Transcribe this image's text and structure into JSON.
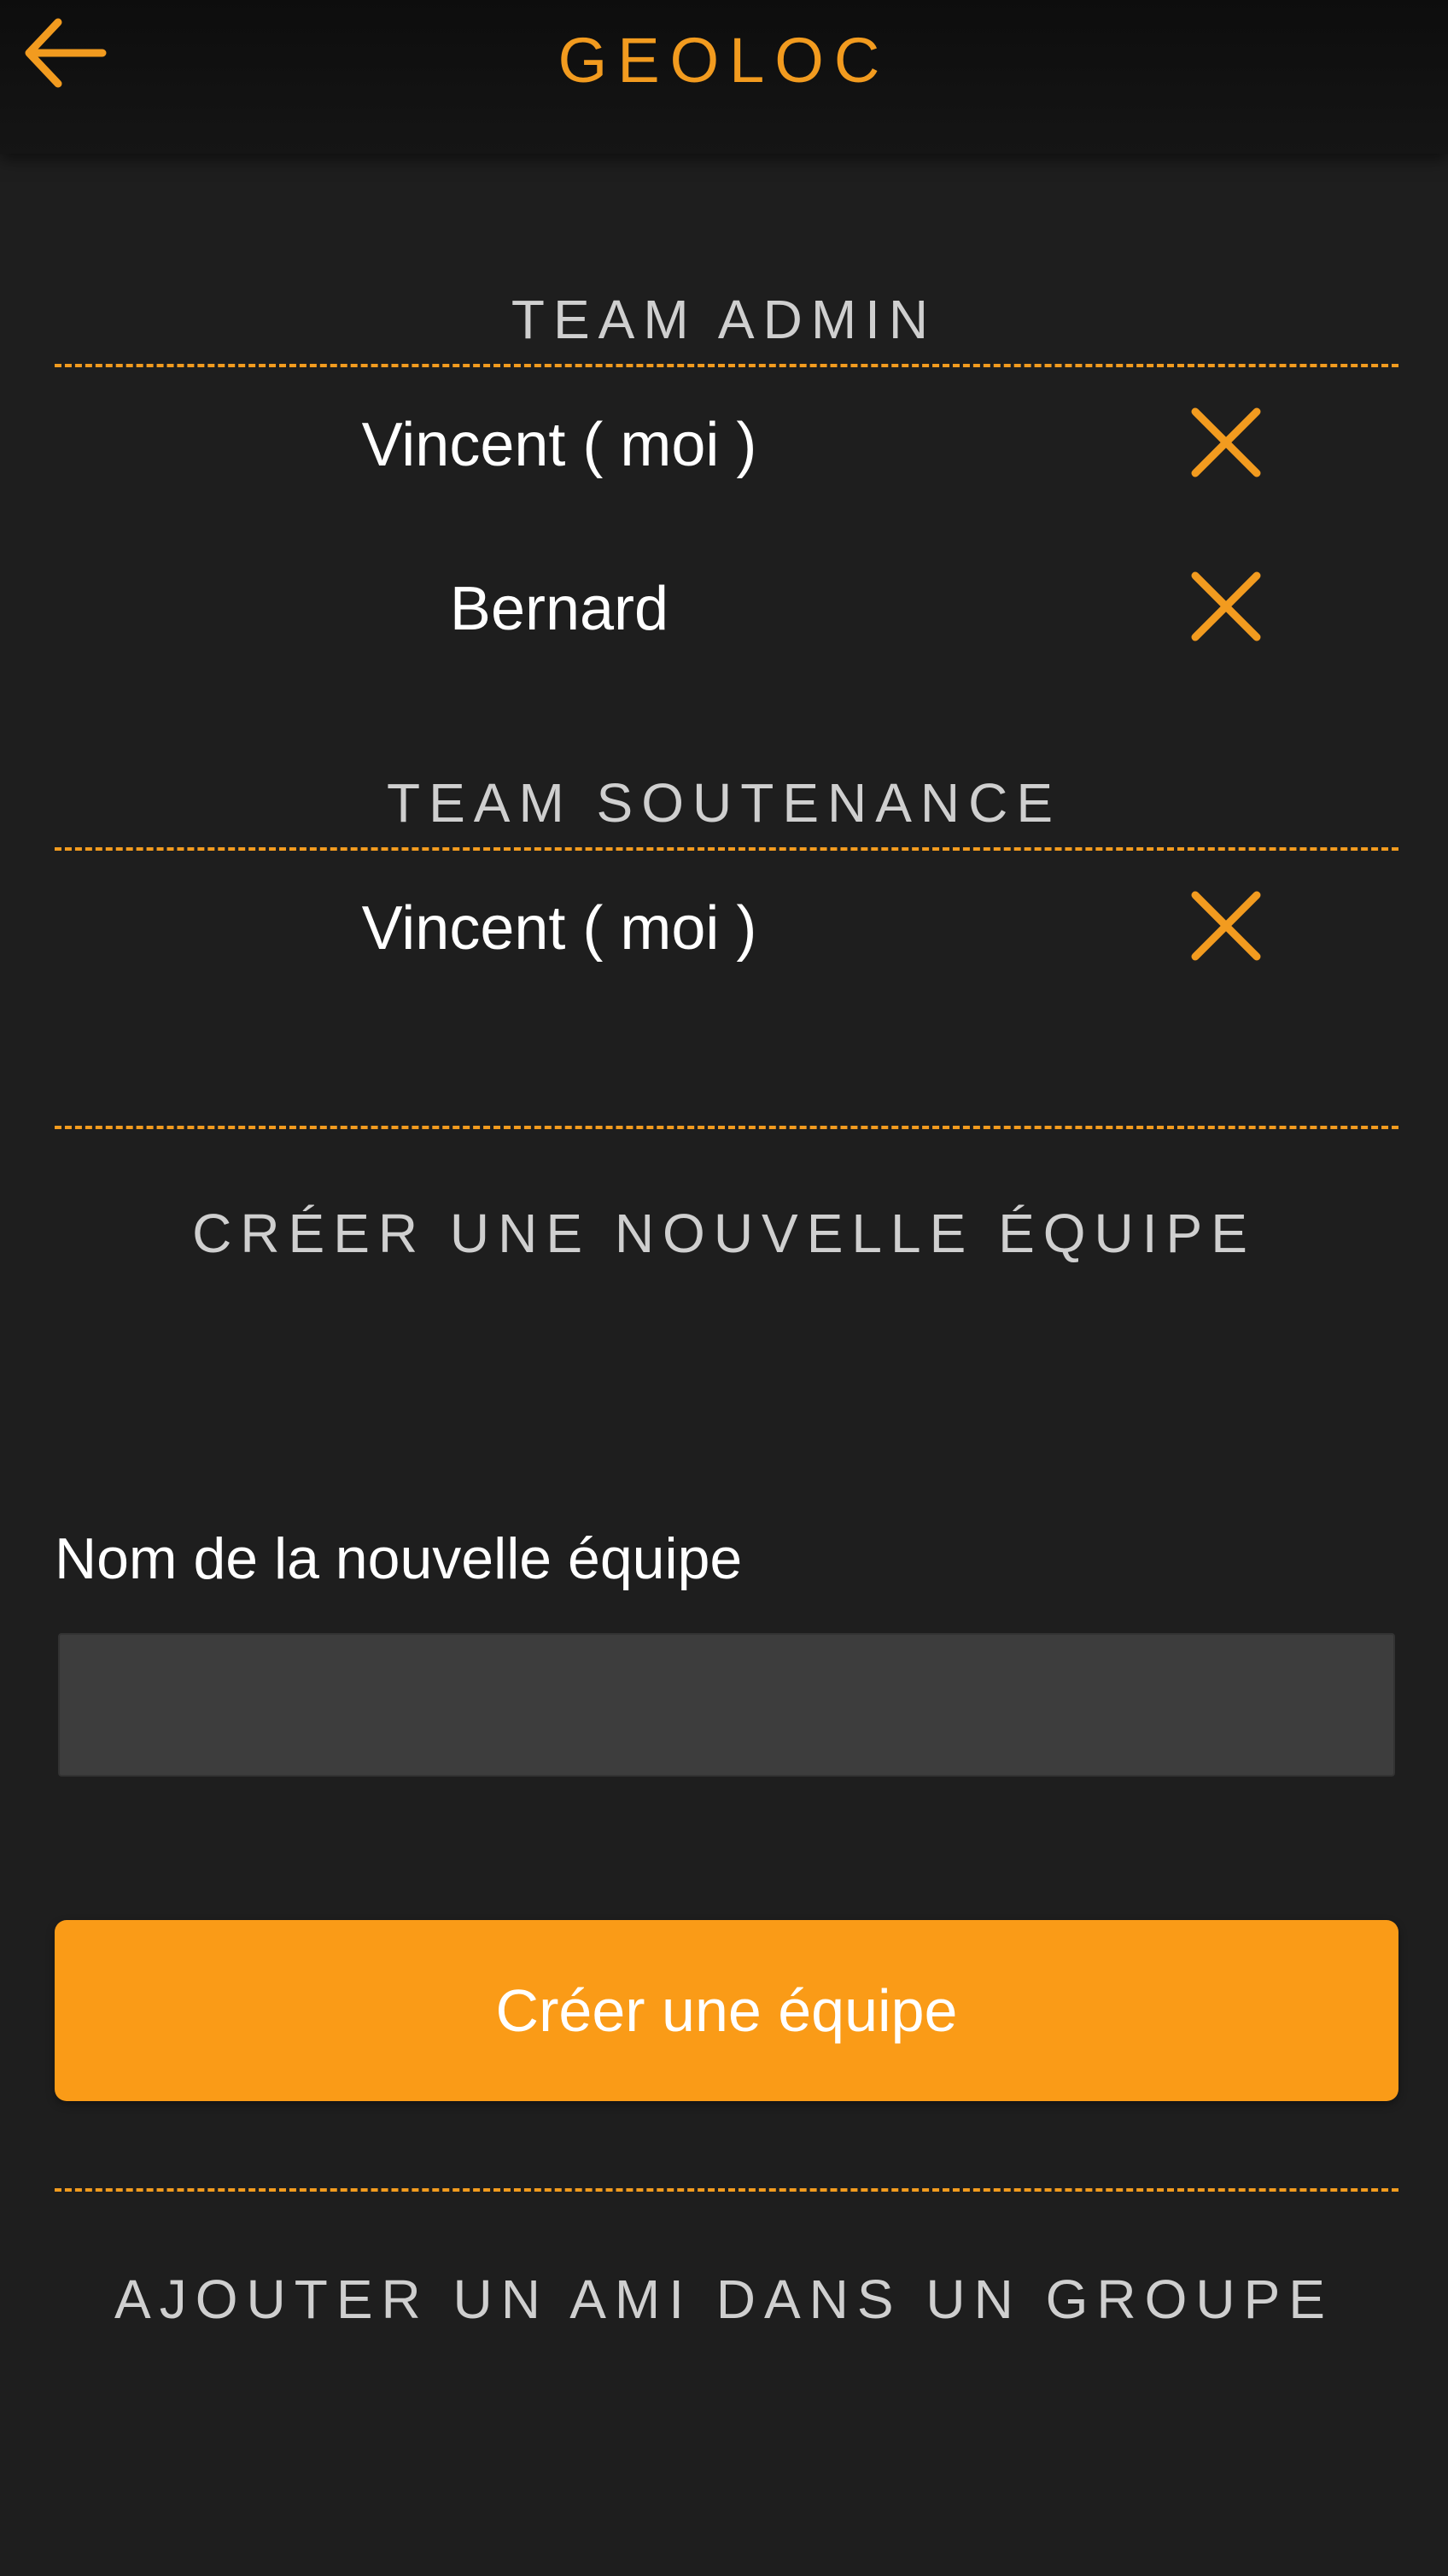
{
  "app": {
    "title": "GEOLOC"
  },
  "icons": {
    "back": "arrow-left-icon",
    "remove": "close-icon"
  },
  "colors": {
    "accent": "#f29b1f",
    "button": "#fa9b17",
    "background": "#1e1e1e",
    "input_bg": "#3d3d3d"
  },
  "teams": [
    {
      "name": "TEAM ADMIN",
      "members": [
        "Vincent ( moi )",
        "Bernard"
      ]
    },
    {
      "name": "TEAM SOUTENANCE",
      "members": [
        "Vincent ( moi )"
      ]
    }
  ],
  "create_team": {
    "heading": "CRÉER UNE NOUVELLE ÉQUIPE",
    "field_label": "Nom de la nouvelle équipe",
    "input_value": "",
    "button_label": "Créer une équipe"
  },
  "add_friend": {
    "heading": "AJOUTER UN AMI DANS UN GROUPE"
  }
}
